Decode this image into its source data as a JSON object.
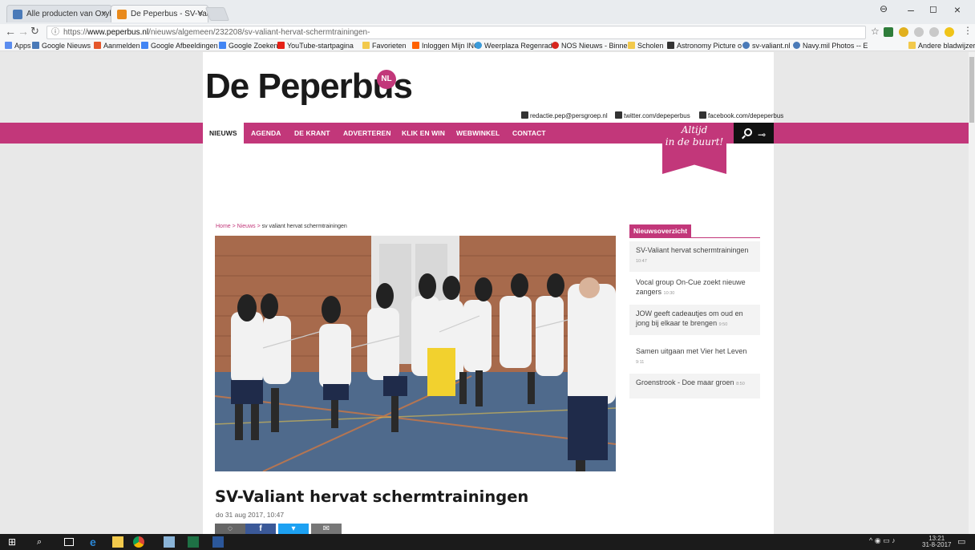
{
  "browser": {
    "tabs": [
      {
        "title": "Alle producten van Oxyl",
        "active": false
      },
      {
        "title": "De Peperbus - SV-Valian",
        "active": true
      }
    ],
    "url_prefix": "https://",
    "url_domain": "www.peperbus.nl",
    "url_path": "/nieuws/algemeen/232208/sv-valiant-hervat-schermtrainingen-",
    "bookmarks": [
      "Apps",
      "Google Nieuws",
      "Aanmelden",
      "Google Afbeeldingen",
      "Google Zoeken",
      "YouTube-startpagina",
      "Favorieten",
      "Inloggen Mijn ING",
      "Weerplaza Regenradi",
      "NOS Nieuws - Binnen",
      "Scholen",
      "Astronomy Picture o",
      "sv-valiant.nl",
      "Navy.mil Photos -- E"
    ],
    "other_bookmarks": "Andere bladwijzers",
    "window_controls": {
      "minimize": "–",
      "maximize": "◻",
      "close": "×"
    }
  },
  "site": {
    "logo": "De Peperbus",
    "logo_badge": "NL",
    "contact": {
      "email": "redactie.pep@persgroep.nl",
      "twitter": "twitter.com/depeperbus",
      "facebook": "facebook.com/depeperbus"
    },
    "nav": [
      "NIEUWS",
      "AGENDA",
      "DE KRANT",
      "ADVERTEREN",
      "KLIK EN WIN",
      "WEBWINKEL",
      "CONTACT"
    ],
    "ribbon_line1": "Altijd",
    "ribbon_line2": "in de buurt!",
    "accent": "#c2377a"
  },
  "article": {
    "breadcrumb_home": "Home",
    "breadcrumb_sep": " > ",
    "breadcrumb_section": "Nieuws",
    "breadcrumb_current": "sv valiant hervat schermtrainingen",
    "title": "SV-Valiant hervat schermtrainingen",
    "date": "do 31 aug 2017, 10:47",
    "share_icons": [
      "comment-icon",
      "facebook-icon",
      "twitter-icon",
      "mail-icon"
    ]
  },
  "sidebar": {
    "heading": "Nieuwsoverzicht",
    "items": [
      {
        "title": "SV-Valiant hervat schermtrainingen",
        "time": "10:47"
      },
      {
        "title": "Vocal group On-Cue zoekt nieuwe zangers",
        "time": "10:30"
      },
      {
        "title": "JOW geeft cadeautjes om oud en jong bij elkaar te brengen",
        "time": "9:50"
      },
      {
        "title": "Samen uitgaan met Vier het Leven",
        "time": "9:11"
      },
      {
        "title": "Groenstrook - Doe maar groen",
        "time": "8:50"
      }
    ]
  },
  "taskbar": {
    "time": "13:21",
    "date": "31-8-2017"
  }
}
